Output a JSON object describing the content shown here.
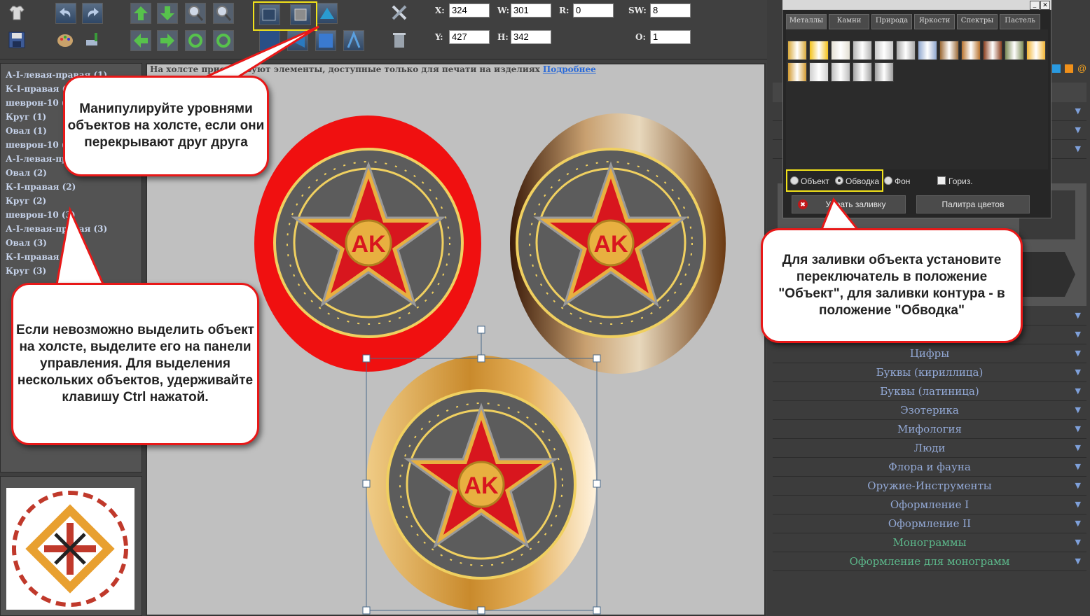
{
  "toolbar": {
    "x_label": "X:",
    "x_value": "324",
    "w_label": "W:",
    "w_value": "301",
    "r_label": "R:",
    "r_value": "0",
    "sw_label": "SW:",
    "sw_value": "8",
    "y_label": "Y:",
    "y_value": "427",
    "h_label": "H:",
    "h_value": "342",
    "o_label": "O:",
    "o_value": "1"
  },
  "objects": [
    "А-I-левая-правая (1)",
    "К-I-правая (1)",
    "шеврон-10 (1)",
    "Круг (1)",
    "Овал (1)",
    "шеврон-10 (2)",
    "А-I-левая-правая (2)",
    "Овал (2)",
    "К-I-правая (2)",
    "Круг (2)",
    "шеврон-10 (3)",
    "А-I-левая-правая (3)",
    "Овал (3)",
    "К-I-правая (3)",
    "Круг (3)"
  ],
  "notice": {
    "text": "На холсте присутствуют элементы, доступные только для печати на изделиях",
    "link": "Подробнее"
  },
  "palette": {
    "tabs": [
      "Металлы",
      "Камни",
      "Природа",
      "Яркости",
      "Спектры",
      "Пастель"
    ],
    "radio_object": "Объект",
    "radio_stroke": "Обводка",
    "radio_bg": "Фон",
    "horiz_label": "Гориз.",
    "remove_fill": "Убрать заливку",
    "color_palette": "Палитра цветов",
    "swatches": [
      "#d9a93a",
      "#f3c21c",
      "#e4e0d4",
      "#b5b5b5",
      "#c8c8c8",
      "#a9a9a9",
      "#8fa7cf",
      "#9b6a37",
      "#b8732e",
      "#8a3e1e",
      "#7b8a55",
      "#f2b534",
      "#d29a30",
      "#cfcfcf",
      "#bdbdbd",
      "#a3a3a3",
      "#9c9c9c"
    ]
  },
  "categories": [
    {
      "label": "Цифры"
    },
    {
      "label": "Буквы (кириллица)"
    },
    {
      "label": "Буквы (латиница)"
    },
    {
      "label": "Эзотерика"
    },
    {
      "label": "Мифология"
    },
    {
      "label": "Люди"
    },
    {
      "label": "Флора и фауна"
    },
    {
      "label": "Оружие-Инструменты"
    },
    {
      "label": "Оформление I"
    },
    {
      "label": "Оформление II"
    },
    {
      "label": "Монограммы"
    },
    {
      "label": "Оформление для монограмм"
    }
  ],
  "callouts": {
    "layers": "Манипулируйте уровнями объектов на холсте, если они перекрывают друг друга",
    "select": "Если невозможно выделить объект на холсте, выделите его на панели управления. Для выделения нескольких объектов, удерживайте клавишу Ctrl нажатой.",
    "fill": "Для заливки объекта установите переключатель в положение \"Объект\", для заливки контура - в положение \"Обводка\""
  },
  "badge_text": "AK",
  "colors": {
    "accent": "#e81818",
    "highlight": "#f2e21a",
    "link": "#2a6ad8"
  }
}
